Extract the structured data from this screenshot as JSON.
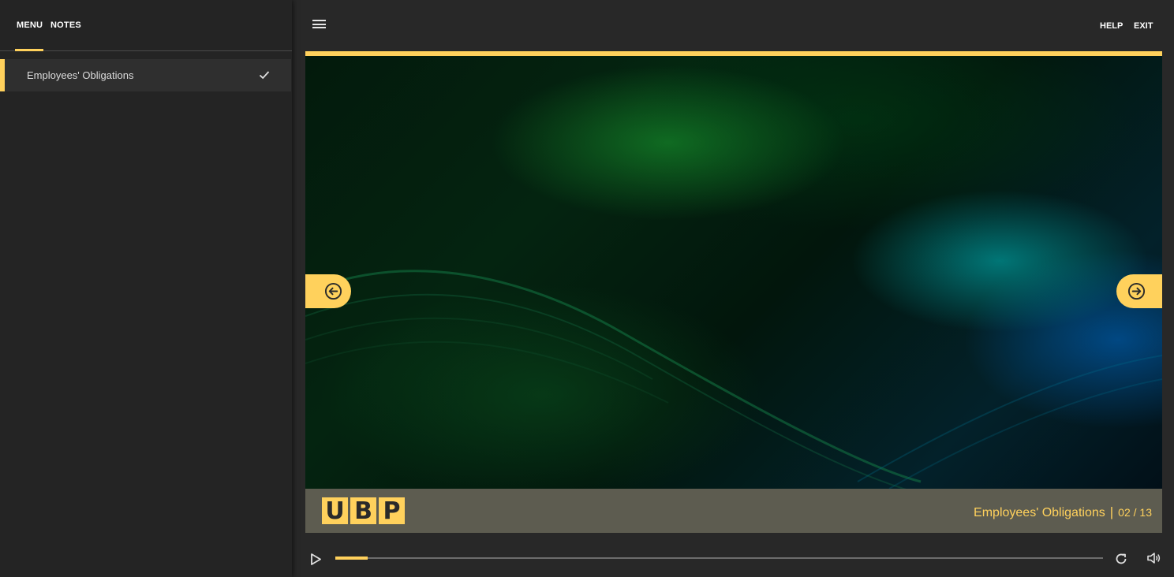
{
  "sidebar": {
    "tabs": [
      {
        "label": "MENU",
        "active": true
      },
      {
        "label": "NOTES",
        "active": false
      }
    ],
    "items": [
      {
        "label": "Employees' Obligations",
        "completed": true,
        "icon": "check-icon"
      }
    ]
  },
  "header": {
    "menu_icon": "hamburger-icon",
    "help_label": "HELP",
    "exit_label": "EXIT"
  },
  "slide": {
    "logo_letters": [
      "U",
      "B",
      "P"
    ],
    "title": "Employees' Obligations",
    "separator": "|",
    "page": "02 / 13",
    "prev_icon": "arrow-left-circle-icon",
    "next_icon": "arrow-right-circle-icon"
  },
  "player": {
    "play_icon": "play-icon",
    "progress_fraction": 0.042,
    "replay_icon": "replay-icon",
    "volume_icon": "volume-icon"
  },
  "colors": {
    "accent": "#ffd15c",
    "sidebar_bg": "#242424",
    "main_bg": "#282828",
    "footer_bg": "#5d5c50"
  }
}
